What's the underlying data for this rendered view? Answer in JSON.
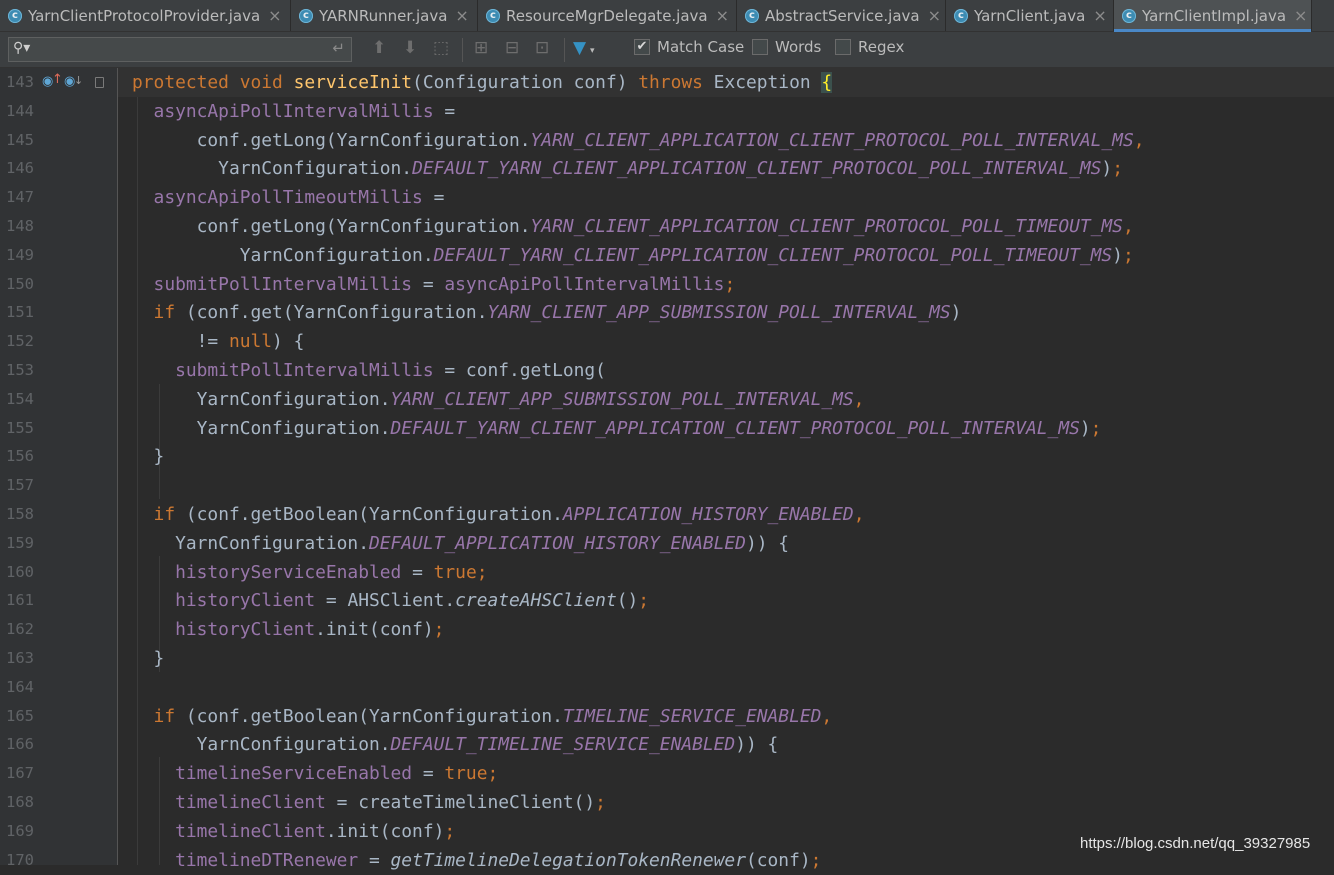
{
  "tabs": [
    {
      "label": "YarnClientProtocolProvider.java",
      "active": false
    },
    {
      "label": "YARNRunner.java",
      "active": false
    },
    {
      "label": "ResourceMgrDelegate.java",
      "active": false
    },
    {
      "label": "AbstractService.java",
      "active": false
    },
    {
      "label": "YarnClient.java",
      "active": false
    },
    {
      "label": "YarnClientImpl.java",
      "active": true
    }
  ],
  "find_bar": {
    "search_value": "",
    "match_case_label": "Match Case",
    "match_case_checked": true,
    "words_label": "Words",
    "words_checked": false,
    "regex_label": "Regex",
    "regex_checked": false
  },
  "editor": {
    "line_numbers": [
      "143",
      "144",
      "145",
      "146",
      "147",
      "148",
      "149",
      "150",
      "151",
      "152",
      "153",
      "154",
      "155",
      "156",
      "157",
      "158",
      "159",
      "160",
      "161",
      "162",
      "163",
      "164",
      "165",
      "166",
      "167",
      "168",
      "169",
      "170"
    ],
    "lines": [
      [
        {
          "t": "protected void ",
          "c": "kw"
        },
        {
          "t": "serviceInit",
          "c": "fn"
        },
        {
          "t": "(Configuration conf) "
        },
        {
          "t": "throws ",
          "c": "kw"
        },
        {
          "t": "Exception "
        },
        {
          "t": "{",
          "c": "brace-hl"
        }
      ],
      [
        {
          "t": "  "
        },
        {
          "t": "asyncApiPollIntervalMillis",
          "c": "fld"
        },
        {
          "t": " ="
        }
      ],
      [
        {
          "t": "      conf.getLong(YarnConfiguration."
        },
        {
          "t": "YARN_CLIENT_APPLICATION_CLIENT_PROTOCOL_POLL_INTERVAL_MS",
          "c": "cst"
        },
        {
          "t": ",",
          "c": "kw"
        }
      ],
      [
        {
          "t": "        YarnConfiguration."
        },
        {
          "t": "DEFAULT_YARN_CLIENT_APPLICATION_CLIENT_PROTOCOL_POLL_INTERVAL_MS",
          "c": "cst"
        },
        {
          "t": ")"
        },
        {
          "t": ";",
          "c": "kw"
        }
      ],
      [
        {
          "t": "  "
        },
        {
          "t": "asyncApiPollTimeoutMillis",
          "c": "fld"
        },
        {
          "t": " ="
        }
      ],
      [
        {
          "t": "      conf.getLong(YarnConfiguration."
        },
        {
          "t": "YARN_CLIENT_APPLICATION_CLIENT_PROTOCOL_POLL_TIMEOUT_MS",
          "c": "cst"
        },
        {
          "t": ",",
          "c": "kw"
        }
      ],
      [
        {
          "t": "          YarnConfiguration."
        },
        {
          "t": "DEFAULT_YARN_CLIENT_APPLICATION_CLIENT_PROTOCOL_POLL_TIMEOUT_MS",
          "c": "cst"
        },
        {
          "t": ")"
        },
        {
          "t": ";",
          "c": "kw"
        }
      ],
      [
        {
          "t": "  "
        },
        {
          "t": "submitPollIntervalMillis",
          "c": "fld"
        },
        {
          "t": " = "
        },
        {
          "t": "asyncApiPollIntervalMillis",
          "c": "fld"
        },
        {
          "t": ";",
          "c": "kw"
        }
      ],
      [
        {
          "t": "  "
        },
        {
          "t": "if ",
          "c": "kw"
        },
        {
          "t": "(conf.get(YarnConfiguration."
        },
        {
          "t": "YARN_CLIENT_APP_SUBMISSION_POLL_INTERVAL_MS",
          "c": "cst"
        },
        {
          "t": ")"
        }
      ],
      [
        {
          "t": "      != "
        },
        {
          "t": "null",
          "c": "kw"
        },
        {
          "t": ") {"
        }
      ],
      [
        {
          "t": "    "
        },
        {
          "t": "submitPollIntervalMillis",
          "c": "fld"
        },
        {
          "t": " = conf.getLong("
        }
      ],
      [
        {
          "t": "      YarnConfiguration."
        },
        {
          "t": "YARN_CLIENT_APP_SUBMISSION_POLL_INTERVAL_MS",
          "c": "cst"
        },
        {
          "t": ",",
          "c": "kw"
        }
      ],
      [
        {
          "t": "      YarnConfiguration."
        },
        {
          "t": "DEFAULT_YARN_CLIENT_APPLICATION_CLIENT_PROTOCOL_POLL_INTERVAL_MS",
          "c": "cst"
        },
        {
          "t": ")"
        },
        {
          "t": ";",
          "c": "kw"
        }
      ],
      [
        {
          "t": "  }"
        }
      ],
      [
        {
          "t": ""
        }
      ],
      [
        {
          "t": "  "
        },
        {
          "t": "if ",
          "c": "kw"
        },
        {
          "t": "(conf.getBoolean(YarnConfiguration."
        },
        {
          "t": "APPLICATION_HISTORY_ENABLED",
          "c": "cst"
        },
        {
          "t": ",",
          "c": "kw"
        }
      ],
      [
        {
          "t": "    YarnConfiguration."
        },
        {
          "t": "DEFAULT_APPLICATION_HISTORY_ENABLED",
          "c": "cst"
        },
        {
          "t": ")) {"
        }
      ],
      [
        {
          "t": "    "
        },
        {
          "t": "historyServiceEnabled",
          "c": "fld"
        },
        {
          "t": " = "
        },
        {
          "t": "true;",
          "c": "kw"
        }
      ],
      [
        {
          "t": "    "
        },
        {
          "t": "historyClient",
          "c": "fld"
        },
        {
          "t": " = AHSClient."
        },
        {
          "t": "createAHSClient",
          "c": "stm"
        },
        {
          "t": "()"
        },
        {
          "t": ";",
          "c": "kw"
        }
      ],
      [
        {
          "t": "    "
        },
        {
          "t": "historyClient",
          "c": "fld"
        },
        {
          "t": ".init(conf)"
        },
        {
          "t": ";",
          "c": "kw"
        }
      ],
      [
        {
          "t": "  }"
        }
      ],
      [
        {
          "t": ""
        }
      ],
      [
        {
          "t": "  "
        },
        {
          "t": "if ",
          "c": "kw"
        },
        {
          "t": "(conf.getBoolean(YarnConfiguration."
        },
        {
          "t": "TIMELINE_SERVICE_ENABLED",
          "c": "cst"
        },
        {
          "t": ",",
          "c": "kw"
        }
      ],
      [
        {
          "t": "      YarnConfiguration."
        },
        {
          "t": "DEFAULT_TIMELINE_SERVICE_ENABLED",
          "c": "cst"
        },
        {
          "t": ")) {"
        }
      ],
      [
        {
          "t": "    "
        },
        {
          "t": "timelineServiceEnabled",
          "c": "fld"
        },
        {
          "t": " = "
        },
        {
          "t": "true;",
          "c": "kw"
        }
      ],
      [
        {
          "t": "    "
        },
        {
          "t": "timelineClient",
          "c": "fld"
        },
        {
          "t": " = createTimelineClient()"
        },
        {
          "t": ";",
          "c": "kw"
        }
      ],
      [
        {
          "t": "    "
        },
        {
          "t": "timelineClient",
          "c": "fld"
        },
        {
          "t": ".init(conf)"
        },
        {
          "t": ";",
          "c": "kw"
        }
      ],
      [
        {
          "t": "    "
        },
        {
          "t": "timelineDTRenewer",
          "c": "fld"
        },
        {
          "t": " = "
        },
        {
          "t": "getTimelineDelegationTokenRenewer",
          "c": "stm"
        },
        {
          "t": "(conf)"
        },
        {
          "t": ";",
          "c": "kw"
        }
      ]
    ]
  },
  "watermark": "https://blog.csdn.net/qq_39327985"
}
